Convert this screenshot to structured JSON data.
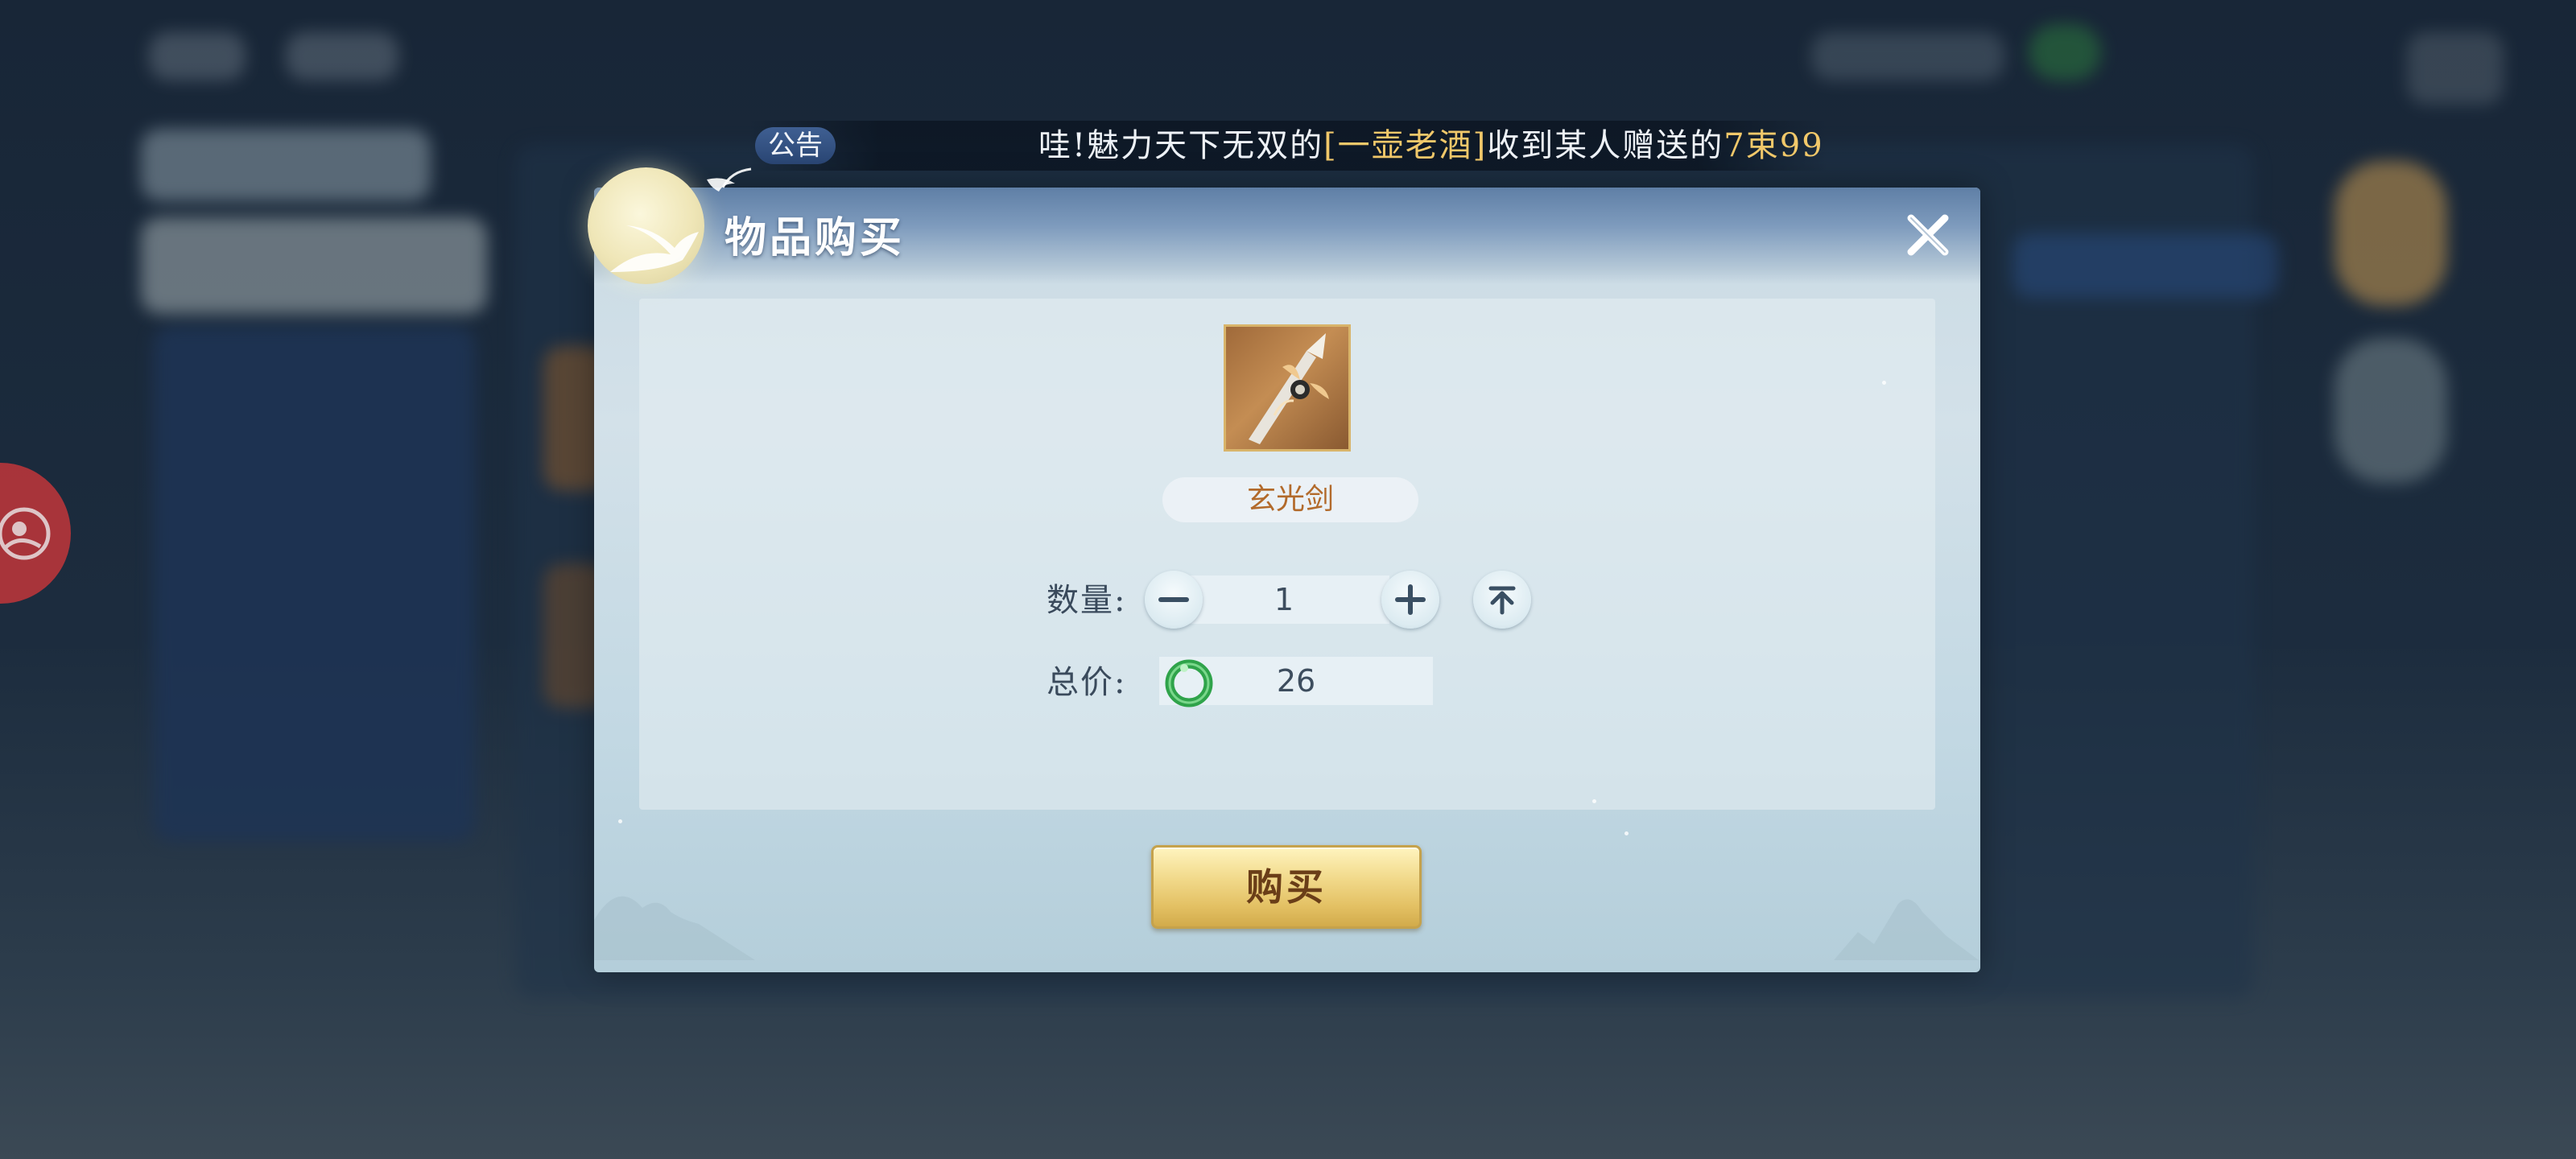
{
  "announcement": {
    "badge": "公告",
    "text_before": "哇!魅力天下无双的",
    "highlight_name": "[一壶老酒]",
    "text_middle": "收到某人赠送的",
    "highlight_count": "7束99"
  },
  "dialog": {
    "title": "物品购买",
    "item": {
      "name": "玄光剑",
      "icon": "sword-icon"
    },
    "quantity": {
      "label": "数量:",
      "value": "1"
    },
    "total_price": {
      "label": "总价:",
      "currency_icon": "jade-currency-icon",
      "value": "26"
    },
    "buy_button": "购买"
  },
  "colors": {
    "item_name": "#b26a2b",
    "highlight": "#f1c86a",
    "buy_button_gold": "#e3c063",
    "side_float": "#b8353a"
  }
}
